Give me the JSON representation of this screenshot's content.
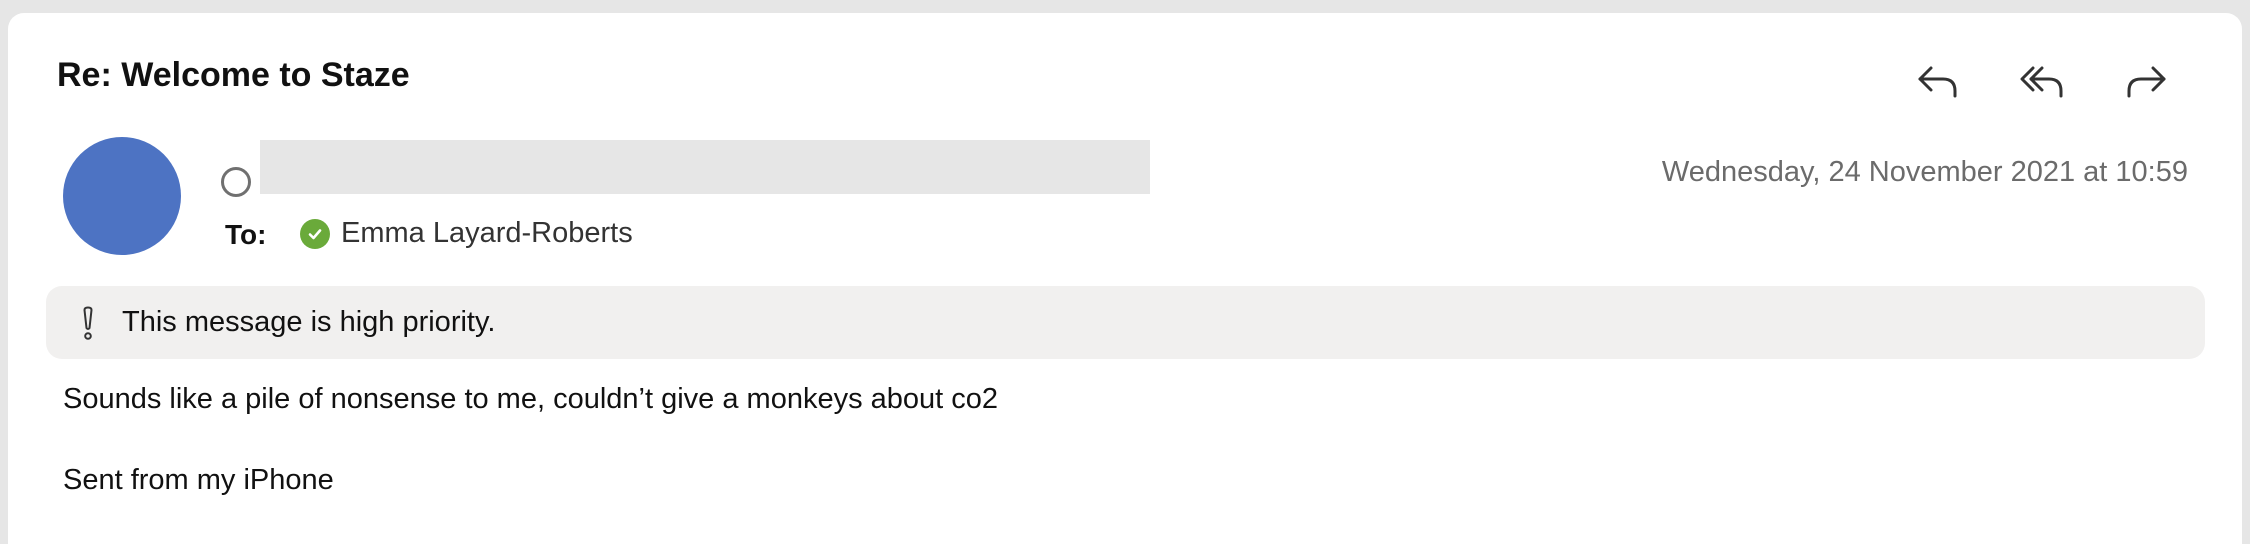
{
  "message": {
    "subject": "Re: Welcome to Staze",
    "date": "Wednesday, 24 November 2021 at 10:59",
    "to_label": "To:",
    "recipient": "Emma Layard-Roberts",
    "priority_notice": "This message is high priority.",
    "body": [
      "Sounds like a pile of nonsense to me, couldn’t give a monkeys about co2",
      "Sent from my iPhone"
    ]
  },
  "actions": [
    "reply-icon",
    "reply-all-icon",
    "forward-icon"
  ],
  "colors": {
    "avatar": "#4d73c3",
    "verified": "#6aaa3a",
    "banner": "#f1f0ef",
    "date_text": "#6b6b6b"
  }
}
